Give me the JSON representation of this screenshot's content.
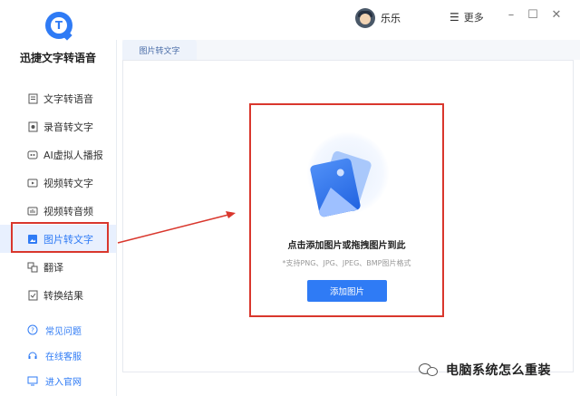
{
  "app": {
    "name": "迅捷文字转语音",
    "logo_letter": "T"
  },
  "sidebar": {
    "items": [
      {
        "label": "文字转语音",
        "icon": "text-file-icon"
      },
      {
        "label": "录音转文字",
        "icon": "recording-icon"
      },
      {
        "label": "AI虚拟人播报",
        "icon": "ai-avatar-icon"
      },
      {
        "label": "视频转文字",
        "icon": "video-icon"
      },
      {
        "label": "视频转音频",
        "icon": "video-audio-icon"
      },
      {
        "label": "图片转文字",
        "icon": "image-text-icon",
        "active": true
      },
      {
        "label": "翻译",
        "icon": "translate-icon"
      },
      {
        "label": "转换结果",
        "icon": "result-icon"
      }
    ],
    "help": [
      {
        "label": "常见问题",
        "icon": "question-icon"
      },
      {
        "label": "在线客服",
        "icon": "headset-icon"
      },
      {
        "label": "进入官网",
        "icon": "website-icon"
      }
    ]
  },
  "topbar": {
    "username": "乐乐",
    "more_label": "更多",
    "icons": {
      "more": "menu-icon",
      "minimize": "minimize-icon",
      "maximize": "maximize-icon",
      "close": "close-icon"
    }
  },
  "tabs": [
    {
      "label": "图片转文字",
      "active": true
    }
  ],
  "upload": {
    "title": "点击添加图片或拖拽图片到此",
    "hint": "*支持PNG、JPG、JPEG、BMP图片格式",
    "button": "添加图片"
  },
  "watermark": {
    "text": "电脑系统怎么重装"
  },
  "colors": {
    "accent": "#2f7bf5",
    "annotation": "#d9372d",
    "active_bg": "#e8f0fe"
  }
}
